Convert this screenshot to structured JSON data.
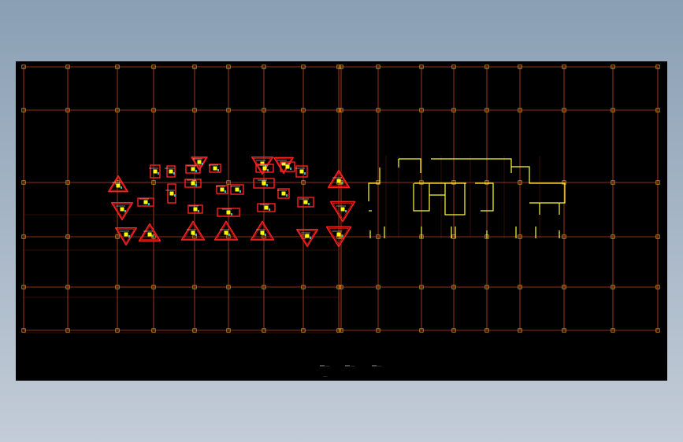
{
  "drawing": {
    "background_color": "#000000",
    "grid_color": "#c2401f",
    "column_marker_color": "#d8a02a",
    "pile_cap_color": "#ff2020",
    "pile_marker_color": "#ffff00",
    "core_wall_color": "#ffff33",
    "label_color": "#ffffff",
    "accent_color": "#22c0c0"
  },
  "legend": {
    "items": [
      {
        "icon": "legend-symbol-icon",
        "label": "———"
      },
      {
        "icon": "legend-symbol-icon",
        "label": "———"
      },
      {
        "icon": "legend-symbol-icon",
        "label": "———"
      }
    ],
    "note": "———"
  }
}
